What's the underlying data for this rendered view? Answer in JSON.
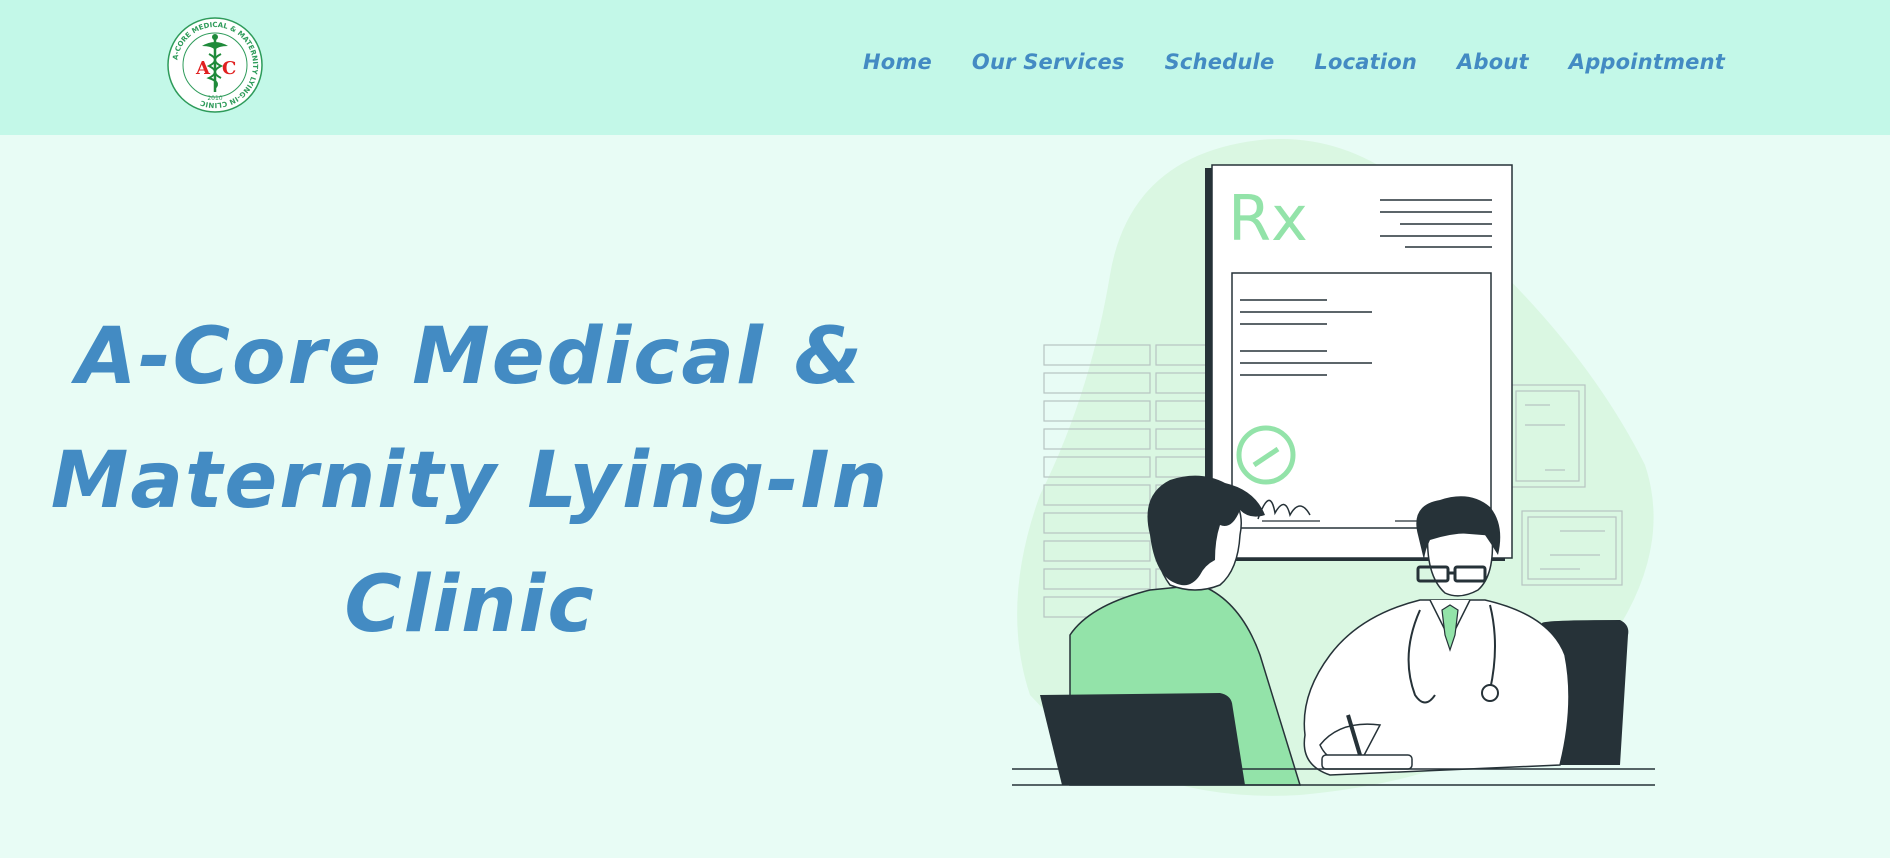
{
  "header": {
    "logo": {
      "text_arc": "A-CORE MEDICAL & MATERNITY LYING-IN CLINIC",
      "initial_left": "A",
      "initial_right": "C",
      "year": "2010",
      "icon": "caduceus-icon"
    },
    "nav": [
      {
        "label": "Home"
      },
      {
        "label": "Our Services"
      },
      {
        "label": "Schedule"
      },
      {
        "label": "Location"
      },
      {
        "label": "About"
      },
      {
        "label": "Appointment"
      }
    ]
  },
  "hero": {
    "title_line1": "A-Core Medical &",
    "title_line2": "Maternity Lying-In",
    "title_line3": "Clinic"
  },
  "illustration": {
    "rx_text": "Rx"
  },
  "colors": {
    "header_bg": "#c3f8e8",
    "page_bg": "#e8fcf5",
    "accent": "#438bc3",
    "green": "#93e3a9",
    "dark": "#263238"
  }
}
